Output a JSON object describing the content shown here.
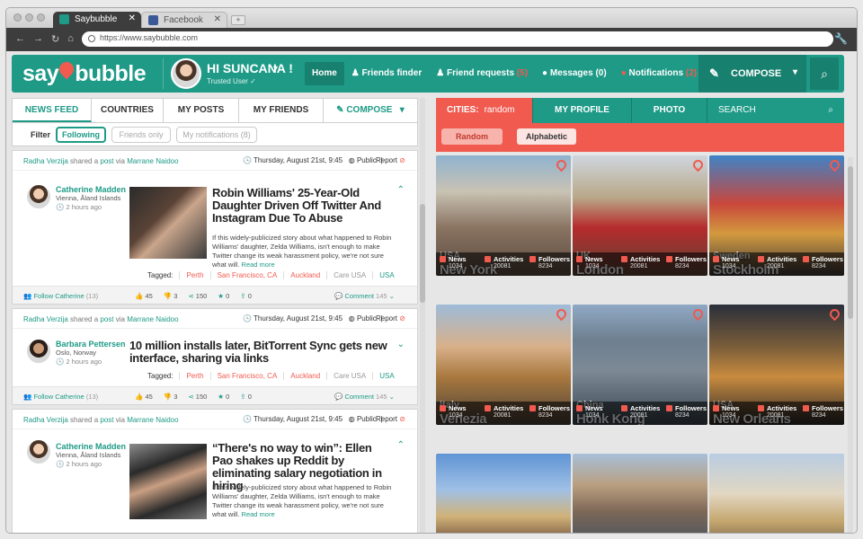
{
  "browser": {
    "tabs": [
      {
        "label": "Saybubble",
        "fav_color": "#1e9a87"
      },
      {
        "label": "Facebook",
        "fav_color": "#3b5998"
      }
    ],
    "url": "https://www.saybubble.com"
  },
  "header": {
    "logo_say": "say",
    "logo_bubble": "bubble",
    "greeting": "HI SUNCANA !",
    "user_status": "Trusted User",
    "menu": [
      {
        "label": "Home"
      },
      {
        "label": "Friends finder"
      },
      {
        "label": "Friend requests",
        "count": "(5)"
      },
      {
        "label": "Messages",
        "count": "(0)"
      },
      {
        "label": "Notifications",
        "count": "(2)"
      }
    ],
    "compose": "COMPOSE"
  },
  "left": {
    "tabs": [
      "NEWS FEED",
      "COUNTRIES",
      "MY POSTS",
      "MY FRIENDS",
      "COMPOSE"
    ],
    "filter_label": "Filter",
    "filters": [
      "Following",
      "Friends only",
      "My notifications (8)"
    ],
    "posts": [
      {
        "shared_by": "Radha Verzija",
        "shared_mid": " shared a ",
        "shared_obj": "post",
        "shared_via": " via ",
        "shared_from": "Marrane Naidoo",
        "date": "Thursday, August 21st, 9:45",
        "privacy": "Public",
        "report": "Report",
        "author": "Catherine Madden",
        "location": "Vienna, Åland Islands",
        "ago": "2 hours ago",
        "title": "Robin Williams' 25-Year-Old Daughter Driven Off Twitter And Instagram Due To Abuse",
        "excerpt": "If this widely-publicized story about what happened to Robin Williams' daughter, Zelda Williams, isn't enough to make Twitter change its weak harassment policy, we're not sure what will.",
        "read_more": "Read more",
        "tagged_label": "Tagged:",
        "tags": [
          {
            "t": "Perth",
            "c": "#f05a4f"
          },
          {
            "t": "San Francisco, CA",
            "c": "#f05a4f"
          },
          {
            "t": "Auckland",
            "c": "#f05a4f"
          },
          {
            "t": "Care USA",
            "c": "#999"
          },
          {
            "t": "USA",
            "c": "#1e9a87"
          }
        ],
        "follow": "Follow Catherine",
        "follow_count": "(13)",
        "stats": [
          "45",
          "3",
          "150",
          "0",
          "0"
        ],
        "comment": "Comment",
        "comment_count": "145"
      },
      {
        "shared_by": "Radha Verzija",
        "shared_mid": " shared a ",
        "shared_obj": "post",
        "shared_via": " via ",
        "shared_from": "Marrane Naidoo",
        "date": "Thursday, August 21st, 9:45",
        "privacy": "Public",
        "report": "Report",
        "author": "Barbara Pettersen",
        "location": "Oslo, Norway",
        "ago": "2 hours ago",
        "title": "10 million installs later, BitTorrent Sync gets new interface, sharing via links",
        "tagged_label": "Tagged:",
        "tags": [
          {
            "t": "Perth",
            "c": "#f05a4f"
          },
          {
            "t": "San Francisco, CA",
            "c": "#f05a4f"
          },
          {
            "t": "Auckland",
            "c": "#f05a4f"
          },
          {
            "t": "Care USA",
            "c": "#999"
          },
          {
            "t": "USA",
            "c": "#1e9a87"
          }
        ],
        "follow": "Follow Catherine",
        "follow_count": "(13)",
        "stats": [
          "45",
          "3",
          "150",
          "0",
          "0"
        ],
        "comment": "Comment",
        "comment_count": "145"
      },
      {
        "shared_by": "Radha Verzija",
        "shared_mid": " shared a ",
        "shared_obj": "post",
        "shared_via": " via ",
        "shared_from": "Marrane Naidoo",
        "date": "Thursday, August 21st, 9:45",
        "privacy": "Public",
        "report": "Report",
        "author": "Catherine Madden",
        "location": "Vienna, Åland Islands",
        "ago": "2 hours ago",
        "title": "“There's no way to win”: Ellen Pao shakes up Reddit by eliminating salary negotiation in hiring",
        "excerpt": "If this widely-publicized story about what happened to Robin Williams' daughter, Zelda Williams, isn't enough to make Twitter change its weak harassment policy, we're not sure what will.",
        "read_more": "Read more"
      }
    ]
  },
  "right": {
    "cities_label": "CITIES:",
    "cities_value": "random",
    "tabs": [
      "MY PROFILE",
      "PHOTO"
    ],
    "search": "SEARCH",
    "sort": [
      "Random",
      "Alphabetic"
    ],
    "stat_labels": [
      "News",
      "Activities",
      "Followers"
    ],
    "cities": [
      {
        "country": "USA",
        "city": "New York",
        "stats": [
          "1034",
          "20081",
          "8234"
        ],
        "bg": "linear-gradient(180deg,#8fb3cf 0%,#c9c2b3 30%,#8a7462 60%,#5a4a3e 100%)"
      },
      {
        "country": "UK",
        "city": "London",
        "stats": [
          "1034",
          "20081",
          "8234"
        ],
        "bg": "linear-gradient(180deg,#cfd6de 0%,#b9a889 35%,#b62b2b 60%,#5c4437 100%)"
      },
      {
        "country": "Sweden",
        "city": "Stockholm",
        "stats": [
          "1034",
          "20081",
          "8234"
        ],
        "bg": "linear-gradient(180deg,#3f83c7 0%,#c9473c 40%,#d39a3e 65%,#3f3a3a 100%)"
      },
      {
        "country": "Italy",
        "city": "Venezia",
        "stats": [
          "1034",
          "20081",
          "8234"
        ],
        "bg": "linear-gradient(180deg,#9ebbd8 0%,#d8b08a 35%,#a9793f 60%,#4b4038 100%)"
      },
      {
        "country": "China",
        "city": "Honk Kong",
        "stats": [
          "1034",
          "20081",
          "8234"
        ],
        "bg": "linear-gradient(180deg,#8fa9c4 0%,#6e7f8f 30%,#7c8a96 55%,#3b4650 100%)"
      },
      {
        "country": "USA",
        "city": "New Orleans",
        "stats": [
          "1034",
          "20081",
          "8234"
        ],
        "bg": "linear-gradient(180deg,#2a2f3a 0%,#7a5d3a 35%,#c88b3f 60%,#2d2a28 100%)"
      },
      {
        "bg": "linear-gradient(180deg,#5f94d4 0%,#9fc0e6 40%,#d1b278 70%,#6c4d3a 100%)"
      },
      {
        "bg": "linear-gradient(180deg,#a7bfd9 0%,#b99f80 35%,#7c6757 65%,#4b5660 100%)"
      },
      {
        "bg": "linear-gradient(180deg,#b9cde2 0%,#e2d7c2 45%,#c5a76e 75%,#7d6b4f 100%)"
      }
    ]
  }
}
